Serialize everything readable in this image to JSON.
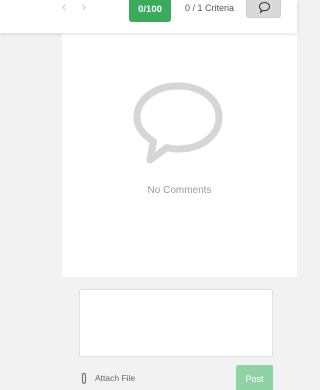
{
  "toolbar": {
    "prev_icon": "chevron-left-icon",
    "next_icon": "chevron-right-icon",
    "score": "0/100",
    "score_color": "#3aaa5c",
    "criteria": "0 / 1 Criteria",
    "comment_icon": "speech-bubble-icon"
  },
  "comments": {
    "empty_icon": "speech-bubble-icon",
    "empty_text": "No Comments"
  },
  "composer": {
    "input_value": "",
    "attach_icon": "paperclip-icon",
    "attach_label": "Attach File",
    "post_label": "Post",
    "post_color": "#8fd3a4"
  }
}
